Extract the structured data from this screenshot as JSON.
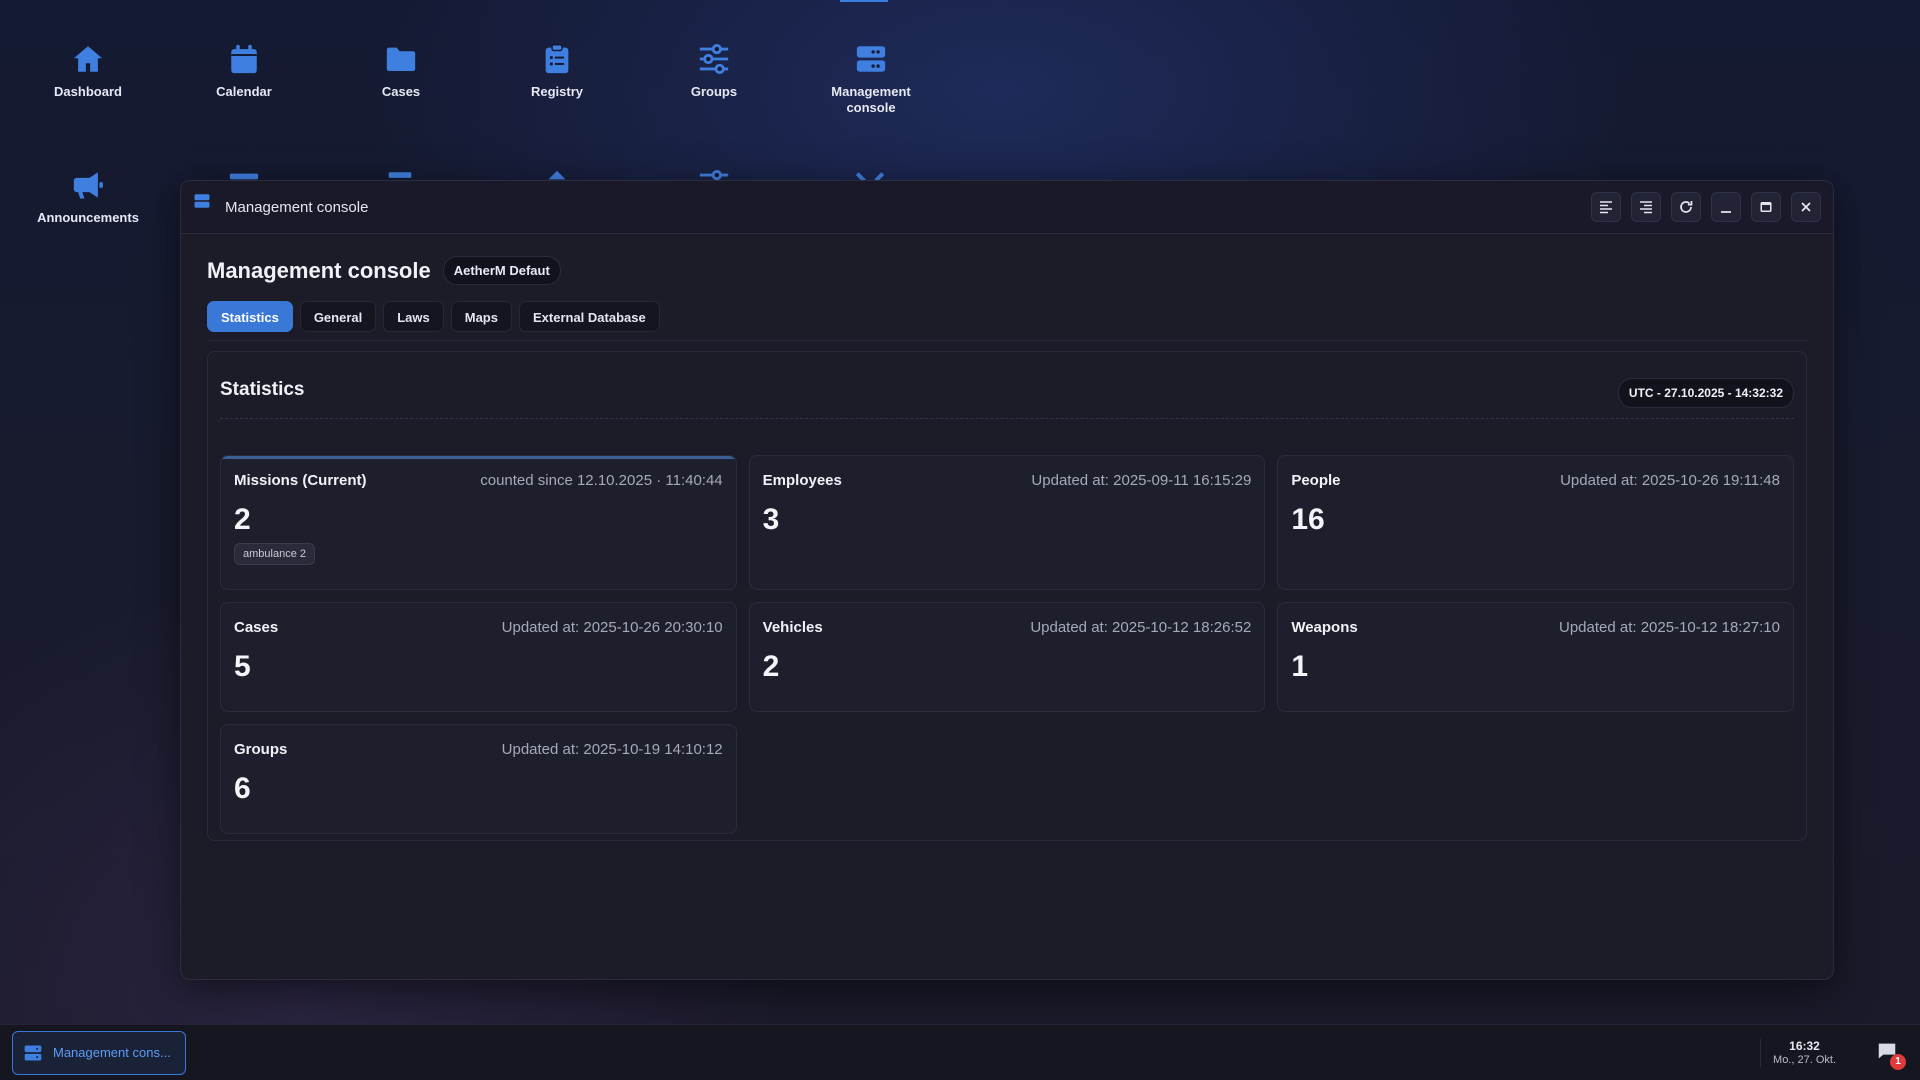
{
  "desktop": {
    "icons": [
      {
        "label": "Dashboard",
        "icon": "home-icon"
      },
      {
        "label": "Calendar",
        "icon": "calendar-icon"
      },
      {
        "label": "Cases",
        "icon": "folder-icon"
      },
      {
        "label": "Registry",
        "icon": "clipboard-icon"
      },
      {
        "label": "Groups",
        "icon": "sliders-icon"
      },
      {
        "label": "Management console",
        "icon": "server-icon"
      },
      {
        "label": "Announcements",
        "icon": "megaphone-icon"
      }
    ]
  },
  "window": {
    "title": "Management console",
    "controls": [
      "align-left-icon",
      "align-right-icon",
      "refresh-icon",
      "minimize-icon",
      "maximize-icon",
      "close-icon"
    ]
  },
  "page": {
    "title": "Management console",
    "badge": "AetherM Defaut",
    "tabs": [
      {
        "label": "Statistics",
        "active": true
      },
      {
        "label": "General",
        "active": false
      },
      {
        "label": "Laws",
        "active": false
      },
      {
        "label": "Maps",
        "active": false
      },
      {
        "label": "External Database",
        "active": false
      }
    ]
  },
  "statistics": {
    "title": "Statistics",
    "utc": "UTC - 27.10.2025 - 14:32:32",
    "cards": [
      {
        "title": "Missions (Current)",
        "meta": "counted since 12.10.2025 · 11:40:44",
        "value": "2",
        "tag": "ambulance 2"
      },
      {
        "title": "Employees",
        "meta": "Updated at: 2025-09-11 16:15:29",
        "value": "3"
      },
      {
        "title": "People",
        "meta": "Updated at: 2025-10-26 19:11:48",
        "value": "16"
      },
      {
        "title": "Cases",
        "meta": "Updated at: 2025-10-26 20:30:10",
        "value": "5"
      },
      {
        "title": "Vehicles",
        "meta": "Updated at: 2025-10-12 18:26:52",
        "value": "2"
      },
      {
        "title": "Weapons",
        "meta": "Updated at: 2025-10-12 18:27:10",
        "value": "1"
      },
      {
        "title": "Groups",
        "meta": "Updated at: 2025-10-19 14:10:12",
        "value": "6"
      }
    ]
  },
  "taskbar": {
    "task_label": "Management cons...",
    "time": "16:32",
    "date": "Mo., 27. Okt.",
    "notification_count": "1"
  },
  "colors": {
    "accent": "#3a78d8",
    "icon_blue": "#3f7fe0",
    "notification": "#e03a3a"
  }
}
